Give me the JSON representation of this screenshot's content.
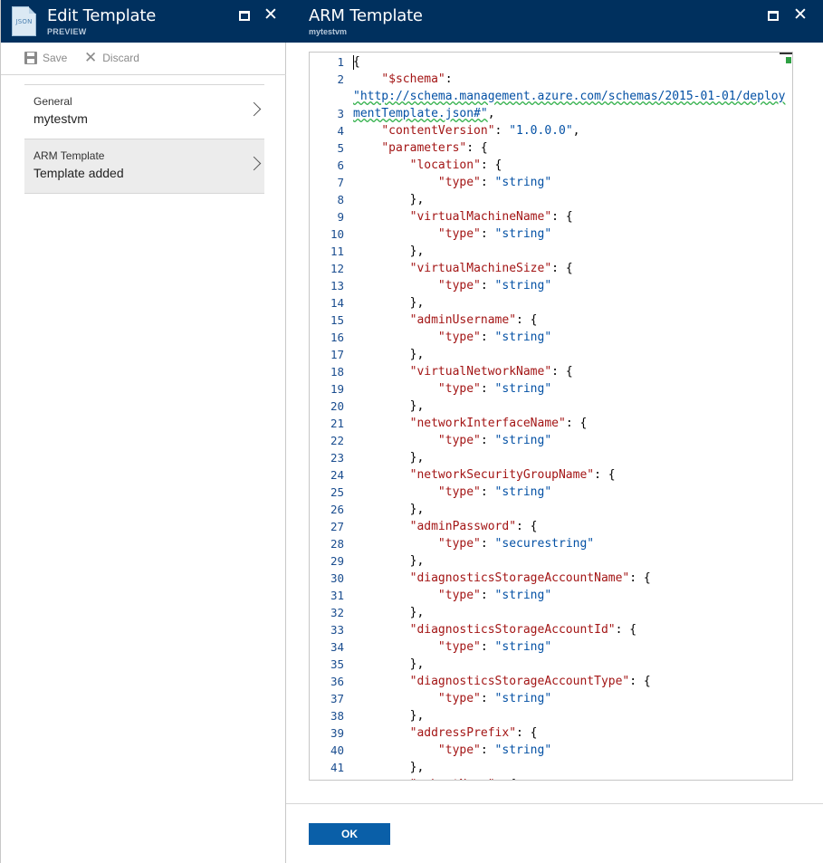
{
  "left_blade": {
    "title": "Edit Template",
    "subtitle": "PREVIEW",
    "icon_text": "JSON",
    "commands": {
      "save": "Save",
      "discard": "Discard"
    },
    "nav_items": [
      {
        "label": "General",
        "value": "mytestvm"
      },
      {
        "label": "ARM Template",
        "value": "Template added"
      }
    ]
  },
  "right_blade": {
    "title": "ARM Template",
    "subtitle": "mytestvm",
    "ok_label": "OK"
  },
  "editor": {
    "line_numbers": [
      "1",
      "2",
      "",
      "3",
      "4",
      "5",
      "6",
      "7",
      "8",
      "9",
      "10",
      "11",
      "12",
      "13",
      "14",
      "15",
      "16",
      "17",
      "18",
      "19",
      "20",
      "21",
      "22",
      "23",
      "24",
      "25",
      "26",
      "27",
      "28",
      "29",
      "30",
      "31",
      "32",
      "33",
      "34",
      "35",
      "36",
      "37",
      "38",
      "39",
      "40",
      "41"
    ],
    "lines": [
      [
        {
          "t": "p",
          "v": "{"
        }
      ],
      [
        {
          "t": "p",
          "v": "    "
        },
        {
          "t": "k",
          "v": "\"$schema\""
        },
        {
          "t": "p",
          "v": ":"
        }
      ],
      [
        {
          "t": "link",
          "v": "\"http://schema.management.azure.com/schemas/2015-01-01/deploy"
        }
      ],
      [
        {
          "t": "link",
          "v": "mentTemplate.json#\""
        },
        {
          "t": "p",
          "v": ","
        }
      ],
      [
        {
          "t": "p",
          "v": "    "
        },
        {
          "t": "k",
          "v": "\"contentVersion\""
        },
        {
          "t": "p",
          "v": ": "
        },
        {
          "t": "s",
          "v": "\"1.0.0.0\""
        },
        {
          "t": "p",
          "v": ","
        }
      ],
      [
        {
          "t": "p",
          "v": "    "
        },
        {
          "t": "k",
          "v": "\"parameters\""
        },
        {
          "t": "p",
          "v": ": {"
        }
      ],
      [
        {
          "t": "p",
          "v": "        "
        },
        {
          "t": "k",
          "v": "\"location\""
        },
        {
          "t": "p",
          "v": ": {"
        }
      ],
      [
        {
          "t": "p",
          "v": "            "
        },
        {
          "t": "k",
          "v": "\"type\""
        },
        {
          "t": "p",
          "v": ": "
        },
        {
          "t": "s",
          "v": "\"string\""
        }
      ],
      [
        {
          "t": "p",
          "v": "        },"
        }
      ],
      [
        {
          "t": "p",
          "v": "        "
        },
        {
          "t": "k",
          "v": "\"virtualMachineName\""
        },
        {
          "t": "p",
          "v": ": {"
        }
      ],
      [
        {
          "t": "p",
          "v": "            "
        },
        {
          "t": "k",
          "v": "\"type\""
        },
        {
          "t": "p",
          "v": ": "
        },
        {
          "t": "s",
          "v": "\"string\""
        }
      ],
      [
        {
          "t": "p",
          "v": "        },"
        }
      ],
      [
        {
          "t": "p",
          "v": "        "
        },
        {
          "t": "k",
          "v": "\"virtualMachineSize\""
        },
        {
          "t": "p",
          "v": ": {"
        }
      ],
      [
        {
          "t": "p",
          "v": "            "
        },
        {
          "t": "k",
          "v": "\"type\""
        },
        {
          "t": "p",
          "v": ": "
        },
        {
          "t": "s",
          "v": "\"string\""
        }
      ],
      [
        {
          "t": "p",
          "v": "        },"
        }
      ],
      [
        {
          "t": "p",
          "v": "        "
        },
        {
          "t": "k",
          "v": "\"adminUsername\""
        },
        {
          "t": "p",
          "v": ": {"
        }
      ],
      [
        {
          "t": "p",
          "v": "            "
        },
        {
          "t": "k",
          "v": "\"type\""
        },
        {
          "t": "p",
          "v": ": "
        },
        {
          "t": "s",
          "v": "\"string\""
        }
      ],
      [
        {
          "t": "p",
          "v": "        },"
        }
      ],
      [
        {
          "t": "p",
          "v": "        "
        },
        {
          "t": "k",
          "v": "\"virtualNetworkName\""
        },
        {
          "t": "p",
          "v": ": {"
        }
      ],
      [
        {
          "t": "p",
          "v": "            "
        },
        {
          "t": "k",
          "v": "\"type\""
        },
        {
          "t": "p",
          "v": ": "
        },
        {
          "t": "s",
          "v": "\"string\""
        }
      ],
      [
        {
          "t": "p",
          "v": "        },"
        }
      ],
      [
        {
          "t": "p",
          "v": "        "
        },
        {
          "t": "k",
          "v": "\"networkInterfaceName\""
        },
        {
          "t": "p",
          "v": ": {"
        }
      ],
      [
        {
          "t": "p",
          "v": "            "
        },
        {
          "t": "k",
          "v": "\"type\""
        },
        {
          "t": "p",
          "v": ": "
        },
        {
          "t": "s",
          "v": "\"string\""
        }
      ],
      [
        {
          "t": "p",
          "v": "        },"
        }
      ],
      [
        {
          "t": "p",
          "v": "        "
        },
        {
          "t": "k",
          "v": "\"networkSecurityGroupName\""
        },
        {
          "t": "p",
          "v": ": {"
        }
      ],
      [
        {
          "t": "p",
          "v": "            "
        },
        {
          "t": "k",
          "v": "\"type\""
        },
        {
          "t": "p",
          "v": ": "
        },
        {
          "t": "s",
          "v": "\"string\""
        }
      ],
      [
        {
          "t": "p",
          "v": "        },"
        }
      ],
      [
        {
          "t": "p",
          "v": "        "
        },
        {
          "t": "k",
          "v": "\"adminPassword\""
        },
        {
          "t": "p",
          "v": ": {"
        }
      ],
      [
        {
          "t": "p",
          "v": "            "
        },
        {
          "t": "k",
          "v": "\"type\""
        },
        {
          "t": "p",
          "v": ": "
        },
        {
          "t": "s",
          "v": "\"securestring\""
        }
      ],
      [
        {
          "t": "p",
          "v": "        },"
        }
      ],
      [
        {
          "t": "p",
          "v": "        "
        },
        {
          "t": "k",
          "v": "\"diagnosticsStorageAccountName\""
        },
        {
          "t": "p",
          "v": ": {"
        }
      ],
      [
        {
          "t": "p",
          "v": "            "
        },
        {
          "t": "k",
          "v": "\"type\""
        },
        {
          "t": "p",
          "v": ": "
        },
        {
          "t": "s",
          "v": "\"string\""
        }
      ],
      [
        {
          "t": "p",
          "v": "        },"
        }
      ],
      [
        {
          "t": "p",
          "v": "        "
        },
        {
          "t": "k",
          "v": "\"diagnosticsStorageAccountId\""
        },
        {
          "t": "p",
          "v": ": {"
        }
      ],
      [
        {
          "t": "p",
          "v": "            "
        },
        {
          "t": "k",
          "v": "\"type\""
        },
        {
          "t": "p",
          "v": ": "
        },
        {
          "t": "s",
          "v": "\"string\""
        }
      ],
      [
        {
          "t": "p",
          "v": "        },"
        }
      ],
      [
        {
          "t": "p",
          "v": "        "
        },
        {
          "t": "k",
          "v": "\"diagnosticsStorageAccountType\""
        },
        {
          "t": "p",
          "v": ": {"
        }
      ],
      [
        {
          "t": "p",
          "v": "            "
        },
        {
          "t": "k",
          "v": "\"type\""
        },
        {
          "t": "p",
          "v": ": "
        },
        {
          "t": "s",
          "v": "\"string\""
        }
      ],
      [
        {
          "t": "p",
          "v": "        },"
        }
      ],
      [
        {
          "t": "p",
          "v": "        "
        },
        {
          "t": "k",
          "v": "\"addressPrefix\""
        },
        {
          "t": "p",
          "v": ": {"
        }
      ],
      [
        {
          "t": "p",
          "v": "            "
        },
        {
          "t": "k",
          "v": "\"type\""
        },
        {
          "t": "p",
          "v": ": "
        },
        {
          "t": "s",
          "v": "\"string\""
        }
      ],
      [
        {
          "t": "p",
          "v": "        },"
        }
      ],
      [
        {
          "t": "p",
          "v": "        "
        },
        {
          "t": "k",
          "v": "\"subnetName\""
        },
        {
          "t": "p",
          "v": ": {"
        }
      ]
    ]
  },
  "colors": {
    "header_bg": "#00305e",
    "accent_button": "#0a5fa8",
    "json_key": "#a31515",
    "json_string": "#0451a5",
    "line_number": "#1a4d8f"
  },
  "icons": {
    "template": "json-file-icon",
    "maximize": "maximize-icon",
    "close": "close-icon",
    "save": "save-icon",
    "discard": "discard-icon",
    "chevron": "chevron-right-icon"
  }
}
